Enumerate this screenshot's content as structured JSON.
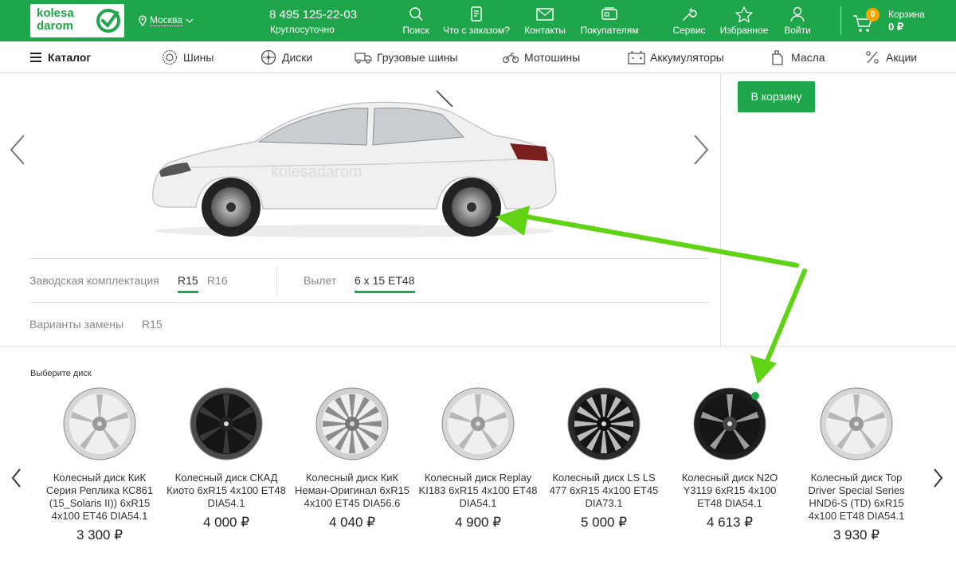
{
  "header": {
    "logo_top": "kolesa",
    "logo_bottom": "darom",
    "city": "Москва",
    "phone": "8 495 125-22-03",
    "hours": "Круглосуточно",
    "nav": [
      {
        "label": "Поиск",
        "icon": "search-icon"
      },
      {
        "label": "Что с заказом?",
        "icon": "order-status-icon"
      },
      {
        "label": "Контакты",
        "icon": "mail-icon"
      },
      {
        "label": "Покупателям",
        "icon": "card-icon"
      },
      {
        "label": "Сервис",
        "icon": "wrench-icon"
      },
      {
        "label": "Избранное",
        "icon": "star-icon"
      },
      {
        "label": "Войти",
        "icon": "user-icon"
      }
    ],
    "cart_count": "0",
    "cart_label": "Корзина",
    "cart_total": "0 ₽"
  },
  "catalog_bar": {
    "catalog_label": "Каталог",
    "items": [
      {
        "label": "Шины",
        "icon": "tire-icon"
      },
      {
        "label": "Диски",
        "icon": "wheel-icon"
      },
      {
        "label": "Грузовые шины",
        "icon": "truck-icon"
      },
      {
        "label": "Мотошины",
        "icon": "motorcycle-icon"
      },
      {
        "label": "Аккумуляторы",
        "icon": "battery-icon"
      },
      {
        "label": "Масла",
        "icon": "oil-icon"
      },
      {
        "label": "Акции",
        "icon": "percent-icon"
      }
    ]
  },
  "preview": {
    "watermark": "kolesadarom",
    "add_to_cart": "В корзину"
  },
  "options": {
    "factory_label": "Заводская комплектация",
    "factory_sizes": [
      "R15",
      "R16"
    ],
    "selected_size": "R15",
    "offset_label": "Вылет",
    "offset_value": "6 x 15 ET48",
    "replacement_label": "Варианты замены",
    "replacement_sizes": [
      "R15"
    ]
  },
  "wheels": {
    "heading": "Выберите диск",
    "items": [
      {
        "name": "Колесный диск КиК Серия Реплика КС861 (15_Solaris II)) 6xR15 4x100 ET46 DIA54.1",
        "price": "3 300 ₽",
        "style": "silver"
      },
      {
        "name": "Колесный диск СКАД Киото 6xR15 4x100 ET48 DIA54.1",
        "price": "4 000 ₽",
        "style": "dark"
      },
      {
        "name": "Колесный диск КиК Неман-Оригинал 6xR15 4x100 ET45 DIA56.6",
        "price": "4 040 ₽",
        "style": "silver-mesh"
      },
      {
        "name": "Колесный диск Replay KI183 6xR15 4x100 ET48 DIA54.1",
        "price": "4 900 ₽",
        "style": "silver"
      },
      {
        "name": "Колесный диск LS LS 477 6xR15 4x100 ET45 DIA73.1",
        "price": "5 000 ₽",
        "style": "black-mesh"
      },
      {
        "name": "Колесный диск N2O Y3119 6xR15 4x100 ET48 DIA54.1",
        "price": "4 613 ₽",
        "style": "black-polished"
      },
      {
        "name": "Колесный диск Top Driver Special Series HND6-S (TD) 6xR15 4x100 ET48 DIA54.1",
        "price": "3 930 ₽",
        "style": "silver"
      }
    ]
  },
  "colors": {
    "brand_green": "#1fa64a",
    "badge_orange": "#f7a600",
    "annotation_arrow": "#5fd314"
  }
}
